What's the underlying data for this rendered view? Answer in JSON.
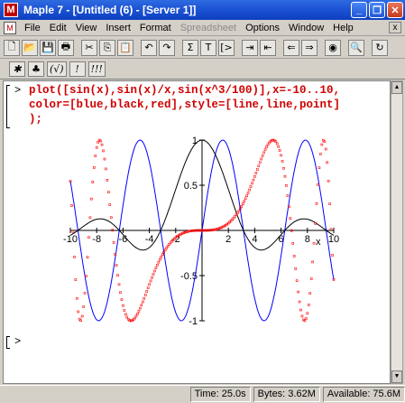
{
  "window": {
    "title": "Maple 7 - [Untitled (6) - [Server 1]]",
    "app_icon_letter": "M",
    "minimize_glyph": "_",
    "restore_glyph": "❐",
    "close_glyph": "✕"
  },
  "menubar": {
    "items": [
      {
        "label": "File",
        "enabled": true
      },
      {
        "label": "Edit",
        "enabled": true
      },
      {
        "label": "View",
        "enabled": true
      },
      {
        "label": "Insert",
        "enabled": true
      },
      {
        "label": "Format",
        "enabled": true
      },
      {
        "label": "Spreadsheet",
        "enabled": false
      },
      {
        "label": "Options",
        "enabled": true
      },
      {
        "label": "Window",
        "enabled": true
      },
      {
        "label": "Help",
        "enabled": true
      }
    ],
    "doc_close_glyph": "x"
  },
  "toolbar": {
    "buttons": [
      {
        "name": "new-icon",
        "glyph": "🗋"
      },
      {
        "name": "open-icon",
        "glyph": "📂"
      },
      {
        "name": "save-icon",
        "glyph": "💾"
      },
      {
        "name": "print-icon",
        "glyph": "🖶"
      },
      {
        "name": "sep"
      },
      {
        "name": "cut-icon",
        "glyph": "✂"
      },
      {
        "name": "copy-icon",
        "glyph": "⎘"
      },
      {
        "name": "paste-icon",
        "glyph": "📋"
      },
      {
        "name": "sep"
      },
      {
        "name": "undo-icon",
        "glyph": "↶"
      },
      {
        "name": "redo-icon",
        "glyph": "↷"
      },
      {
        "name": "sep"
      },
      {
        "name": "sigma-icon",
        "glyph": "Σ"
      },
      {
        "name": "text-icon",
        "glyph": "T"
      },
      {
        "name": "prompt-icon",
        "glyph": "[>"
      },
      {
        "name": "sep"
      },
      {
        "name": "indent-icon",
        "glyph": "⇥"
      },
      {
        "name": "outdent-icon",
        "glyph": "⇤"
      },
      {
        "name": "sep"
      },
      {
        "name": "back-icon",
        "glyph": "⇐"
      },
      {
        "name": "forward-icon",
        "glyph": "⇒"
      },
      {
        "name": "sep"
      },
      {
        "name": "stop-icon",
        "glyph": "◉"
      },
      {
        "name": "sep"
      },
      {
        "name": "zoom-icon",
        "glyph": "🔍"
      },
      {
        "name": "sep"
      },
      {
        "name": "restart-icon",
        "glyph": "↻"
      }
    ]
  },
  "toolbar2": {
    "buttons": [
      {
        "name": "tool-a-icon",
        "glyph": "✱"
      },
      {
        "name": "tool-b-icon",
        "glyph": "♣"
      },
      {
        "name": "tool-c-icon",
        "glyph": "(√)"
      },
      {
        "name": "tool-d-icon",
        "glyph": "!"
      },
      {
        "name": "tool-e-icon",
        "glyph": "!!!"
      }
    ]
  },
  "worksheet": {
    "prompt_symbol": ">",
    "code_lines": [
      "plot([sin(x),sin(x)/x,sin(x^3/100)],x=-10..10,",
      "color=[blue,black,red],style=[line,line,point]",
      ");"
    ],
    "empty_prompt_symbol": ">"
  },
  "chart_data": {
    "type": "line",
    "x_label": "x",
    "xlim": [
      -10,
      10
    ],
    "ylim": [
      -1,
      1
    ],
    "x_ticks": [
      -10,
      -8,
      -6,
      -4,
      -2,
      2,
      4,
      6,
      8,
      10
    ],
    "x_tick_labels": [
      "-10",
      "-8",
      "-6",
      "-4",
      "-2",
      "2",
      "4",
      "6",
      "8",
      "10"
    ],
    "y_ticks": [
      -1,
      -0.5,
      0.5,
      1
    ],
    "y_tick_labels": [
      "-1",
      "-0.5",
      "0.5",
      "1"
    ],
    "series": [
      {
        "expression": "sin(x)",
        "color": "#0000ff",
        "style": "line"
      },
      {
        "expression": "sin(x)/x",
        "color": "#000000",
        "style": "line"
      },
      {
        "expression": "sin(x^3/100)",
        "color": "#ff0000",
        "style": "point"
      }
    ],
    "sample_count": 200
  },
  "statusbar": {
    "time": "Time: 25.0s",
    "bytes": "Bytes: 3.62M",
    "available": "Available: 75.6M"
  },
  "colors": {
    "titlebar": "#1f56d6",
    "code_text": "#d00000",
    "worksheet_bg": "#ffffff",
    "chrome": "#d4d0c8"
  }
}
